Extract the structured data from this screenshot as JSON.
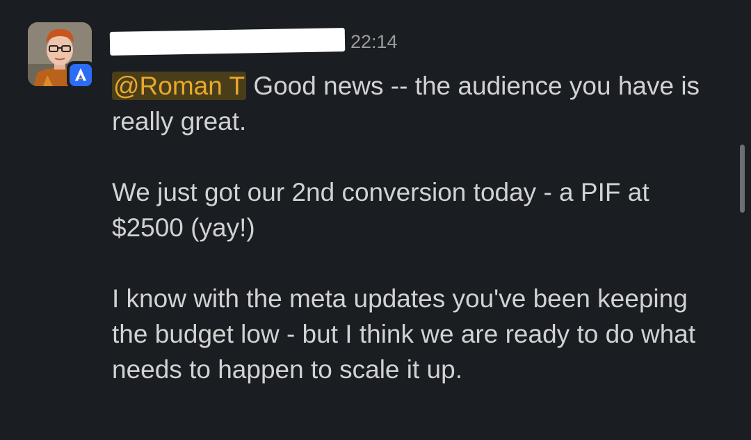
{
  "message": {
    "author_name": "",
    "timestamp": "22:14",
    "mention": "@Roman T",
    "paragraphs": [
      " Good news -- the audience you have is really great.",
      "We just got our 2nd conversion today - a PIF at $2500 (yay!)",
      "I know with the meta updates you've been keeping the budget low - but I think we are ready to do what needs to happen to scale it up."
    ]
  },
  "avatar": {
    "icon": "user-avatar-photo",
    "app_badge_icon": "rocket-app-icon",
    "app_badge_color": "#2d6df6"
  },
  "colors": {
    "background": "#1a1d21",
    "text": "#d1d2d3",
    "mention_text": "#e8a92c",
    "mention_bg": "#4a3d1a",
    "timestamp": "#9a9b9d"
  }
}
